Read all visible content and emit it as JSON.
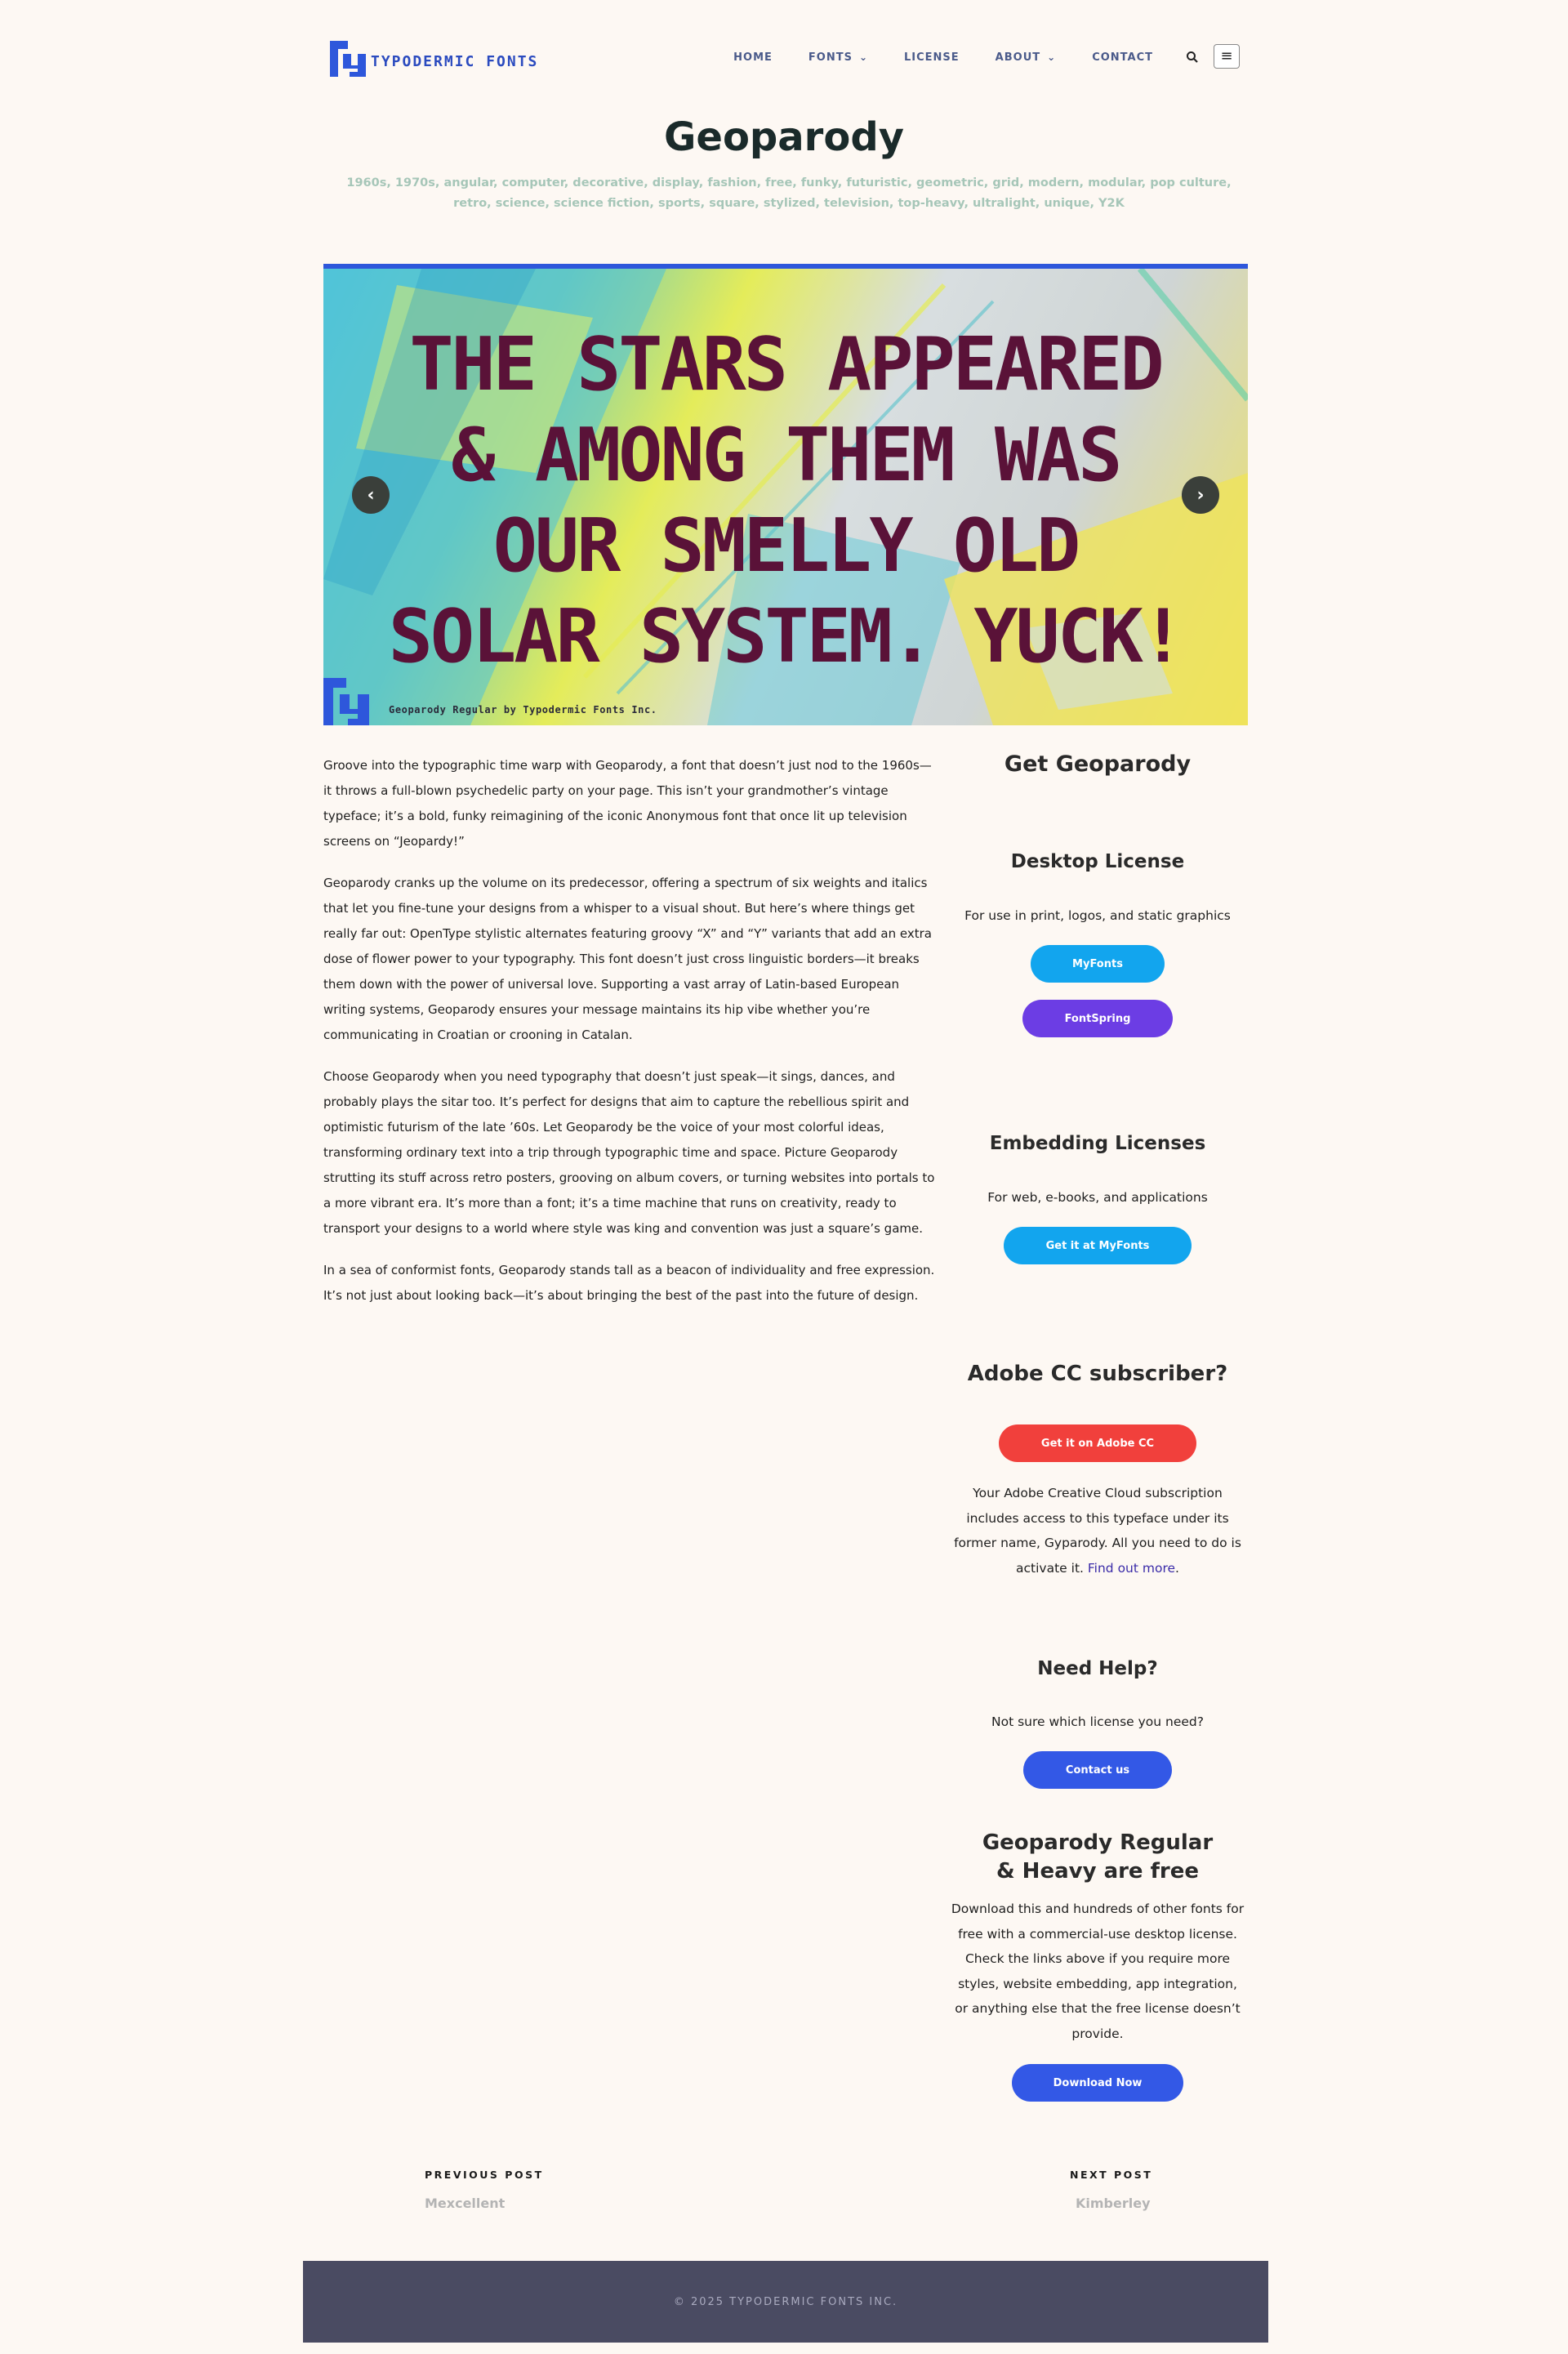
{
  "site": {
    "logo_text": "TYPODERMIC FONTS",
    "brand_color": "#2e57db"
  },
  "nav": {
    "items": [
      {
        "label": "HOME",
        "has_dropdown": false
      },
      {
        "label": "FONTS",
        "has_dropdown": true
      },
      {
        "label": "LICENSE",
        "has_dropdown": false
      },
      {
        "label": "ABOUT",
        "has_dropdown": true
      },
      {
        "label": "CONTACT",
        "has_dropdown": false
      }
    ],
    "search_icon": "search-icon",
    "menu_icon": "hamburger-menu-icon"
  },
  "page": {
    "title": "Geoparody",
    "tags": "1960s, 1970s, angular, computer, decorative, display, fashion, free, funky, futuristic, geometric, grid, modern, modular, pop culture, retro, science, science fiction, sports, square, stylized, television, top-heavy, ultralight, unique, Y2K"
  },
  "hero": {
    "lines": [
      "THE STARS APPEARED",
      "& AMONG THEM WAS",
      "OUR SMELLY OLD",
      "SOLAR SYSTEM. YUCK!"
    ],
    "caption": "Geoparody Regular by Typodermic Fonts Inc.",
    "prev_icon": "‹",
    "next_icon": "›"
  },
  "article": {
    "paragraphs": [
      "Groove into the typographic time warp with Geoparody, a font that doesn’t just nod to the 1960s—it throws a full-blown psychedelic party on your page. This isn’t your grandmother’s vintage typeface; it’s a bold, funky reimagining of the iconic Anonymous font that once lit up television screens on “Jeopardy!”",
      "Geoparody cranks up the volume on its predecessor, offering a spectrum of six weights and italics that let you fine-tune your designs from a whisper to a visual shout. But here’s where things get really far out: OpenType stylistic alternates featuring groovy “X” and “Y” variants that add an extra dose of flower power to your typography. This font doesn’t just cross linguistic borders—it breaks them down with the power of universal love. Supporting a vast array of Latin-based European writing systems, Geoparody ensures your message maintains its hip vibe whether you’re communicating in Croatian or crooning in Catalan.",
      "Choose Geoparody when you need typography that doesn’t just speak—it sings, dances, and probably plays the sitar too. It’s perfect for designs that aim to capture the rebellious spirit and optimistic futurism of the late ’60s. Let Geoparody be the voice of your most colorful ideas, transforming ordinary text into a trip through typographic time and space. Picture Geoparody strutting its stuff across retro posters, grooving on album covers, or turning websites into portals to a more vibrant era. It’s more than a font; it’s a time machine that runs on creativity, ready to transport your designs to a world where style was king and convention was just a square’s game.",
      "In a sea of conformist fonts, Geoparody stands tall as a beacon of individuality and free expression. It’s not just about looking back—it’s about bringing the best of the past into the future of design."
    ]
  },
  "sidebar": {
    "get_heading": "Get Geoparody",
    "desktop": {
      "heading": "Desktop License",
      "text": "For use in print, logos, and static graphics",
      "buttons": [
        {
          "label": "MyFonts",
          "color": "#12a5ee"
        },
        {
          "label": "FontSpring",
          "color": "#6c3de4"
        }
      ]
    },
    "embedding": {
      "heading": "Embedding Licenses",
      "text": "For web, e-books, and applications",
      "button": {
        "label": "Get it at MyFonts",
        "color": "#12a5ee"
      }
    },
    "adobe": {
      "heading": "Adobe CC subscriber?",
      "button": {
        "label": "Get it on Adobe CC",
        "color": "#f1403c"
      },
      "text": "Your Adobe Creative Cloud subscription includes access to this typeface under its former name, Gyparody. All you need to do is activate it.",
      "link": "Find out more"
    },
    "help": {
      "heading": "Need Help?",
      "text": "Not sure which license you need?",
      "button": {
        "label": "Contact us",
        "color": "#3358e6"
      }
    },
    "free": {
      "heading": "Geoparody Regular & Heavy are free",
      "text": "Download this and hundreds of other fonts for free with a commercial-use desktop license. Check the links above if you require more styles, website embedding, app integration, or anything else that the free license doesn’t provide.",
      "button": {
        "label": "Download Now",
        "color": "#3358e6"
      }
    }
  },
  "post_nav": {
    "previous_label": "PREVIOUS POST",
    "previous_title": "Mexcellent",
    "next_label": "NEXT POST",
    "next_title": "Kimberley"
  },
  "footer": {
    "text": "© 2025 TYPODERMIC FONTS INC."
  }
}
